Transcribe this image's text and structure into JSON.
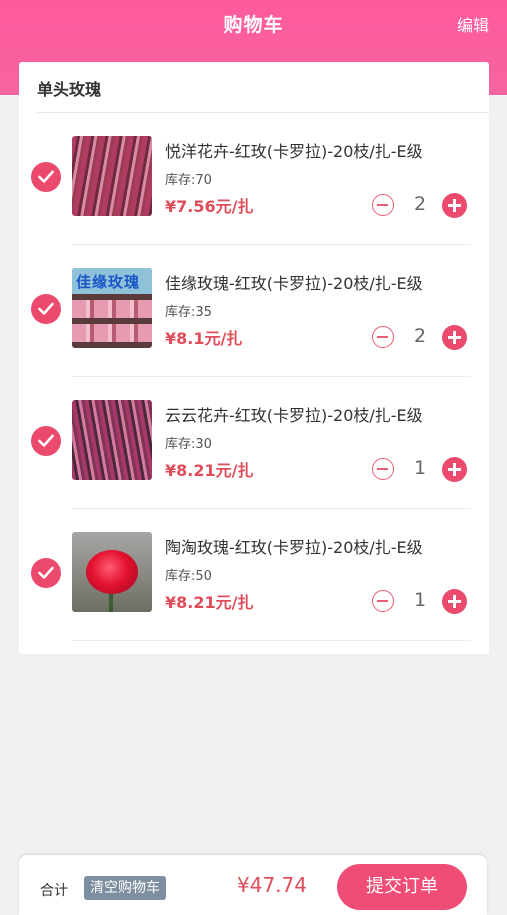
{
  "header": {
    "title": "购物车",
    "edit_label": "编辑"
  },
  "group": {
    "title": "单头玫瑰"
  },
  "items": [
    {
      "name": "悦洋花卉-红玫(卡罗拉)-20枝/扎-E级",
      "stock": "库存:70",
      "price": "¥7.56元/扎",
      "qty": "2",
      "checked": true,
      "image": "red-rose-bundle"
    },
    {
      "name": "佳缘玫瑰-红玫(卡罗拉)-20枝/扎-E级",
      "stock": "库存:35",
      "price": "¥8.1元/扎",
      "qty": "2",
      "checked": true,
      "image": "pink-rose-box",
      "image_text": "佳缘玫瑰"
    },
    {
      "name": "云云花卉-红玫(卡罗拉)-20枝/扎-E级",
      "stock": "库存:30",
      "price": "¥8.21元/扎",
      "qty": "1",
      "checked": true,
      "image": "red-rose-bundle"
    },
    {
      "name": "陶淘玫瑰-红玫(卡罗拉)-20枝/扎-E级",
      "stock": "库存:50",
      "price": "¥8.21元/扎",
      "qty": "1",
      "checked": true,
      "image": "single-red-rose"
    }
  ],
  "footer": {
    "total_label": "合计",
    "clear_label": "清空购物车",
    "total": "¥47.74",
    "submit_label": "提交订单"
  },
  "colors": {
    "brand": "#ff5a9d",
    "accent": "#ec4a6d",
    "price": "#e04d5a"
  }
}
